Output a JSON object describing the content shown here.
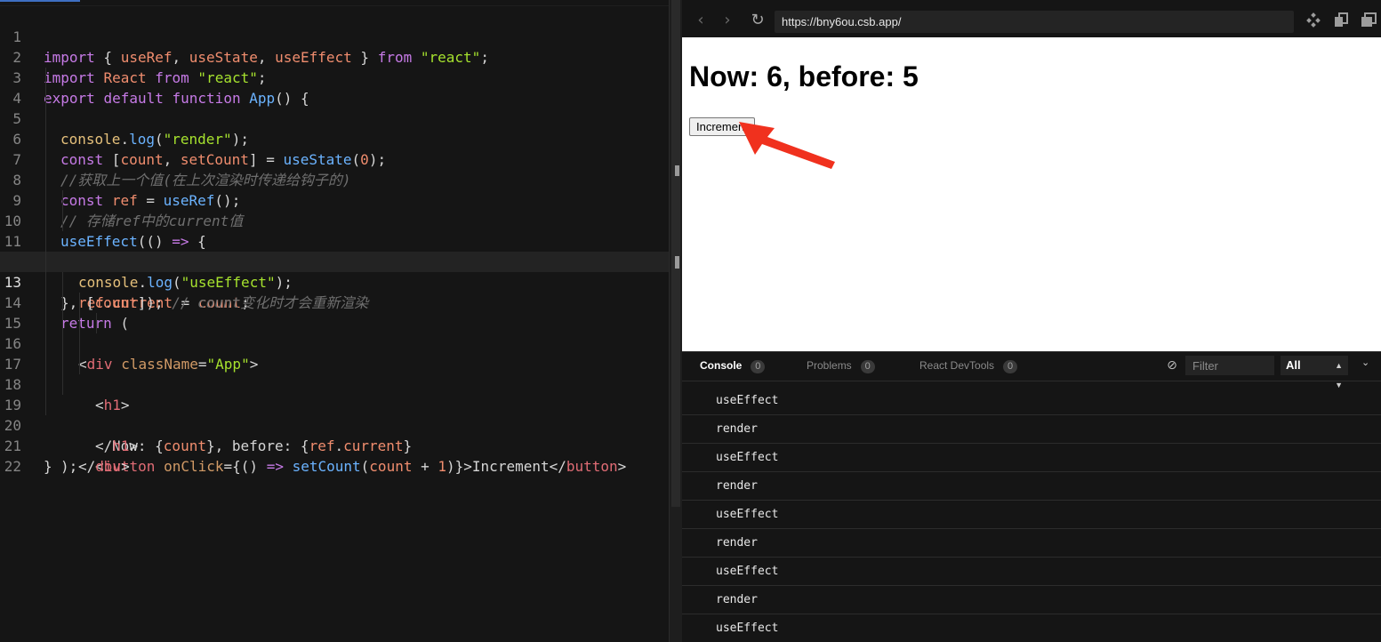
{
  "editor": {
    "lines": [
      {
        "n": "1"
      },
      {
        "n": "2"
      },
      {
        "n": "3"
      },
      {
        "n": "4"
      },
      {
        "n": "5"
      },
      {
        "n": "6"
      },
      {
        "n": "7"
      },
      {
        "n": "8"
      },
      {
        "n": "9"
      },
      {
        "n": "10"
      },
      {
        "n": "11"
      },
      {
        "n": "12"
      },
      {
        "n": "13"
      },
      {
        "n": "14"
      },
      {
        "n": "15"
      },
      {
        "n": "16"
      },
      {
        "n": "17"
      },
      {
        "n": "18"
      },
      {
        "n": "19"
      },
      {
        "n": "20"
      },
      {
        "n": "21"
      },
      {
        "n": "22"
      }
    ],
    "current_line": 13,
    "code": {
      "l1": {
        "import": "import",
        "open": " { ",
        "useRef": "useRef",
        "c1": ", ",
        "useState": "useState",
        "c2": ", ",
        "useEffect": "useEffect",
        "close": " } ",
        "from": "from",
        "sp": " ",
        "str": "\"react\"",
        "semi": ";"
      },
      "l2": {
        "import": "import",
        "sp": " ",
        "React": "React",
        "sp2": " ",
        "from": "from",
        "sp3": " ",
        "str": "\"react\"",
        "semi": ";"
      },
      "l3": {
        "export": "export",
        "sp": " ",
        "default": "default",
        "sp2": " ",
        "function": "function",
        "sp3": " ",
        "App": "App",
        "rest": "() {"
      },
      "l4": {
        "console": "console",
        "dot": ".",
        "log": "log",
        "open": "(",
        "str": "\"render\"",
        "close": ");"
      },
      "l5": {
        "const": "const",
        "open": " [",
        "count": "count",
        "c": ", ",
        "setCount": "setCount",
        "eq": "] = ",
        "useState": "useState",
        "p1": "(",
        "num": "0",
        "p2": ");"
      },
      "l6": {
        "comment": "//获取上一个值(在上次渲染时传递给钩子的)"
      },
      "l7": {
        "const": "const",
        "sp": " ",
        "ref": "ref",
        "eq": " = ",
        "useRef": "useRef",
        "rest": "();"
      },
      "l8": {
        "comment": "// 存储ref中的current值"
      },
      "l9": {
        "useEffect": "useEffect",
        "open": "(() ",
        "arrow": "=>",
        "rest": " {"
      },
      "l10": {
        "console": "console",
        "dot": ".",
        "log": "log",
        "open": "(",
        "str": "\"useEffect\"",
        "close": ");"
      },
      "l11": {
        "ref": "ref",
        "dot": ".",
        "current": "current",
        "eq": " = ",
        "count": "count",
        "semi": ";"
      },
      "l12": {
        "open": "}, [",
        "count": "count",
        "close": "]); ",
        "comment": "// count变化时才会重新渲染"
      },
      "l13": {
        "return": "return",
        "rest": " ("
      },
      "l14": {
        "lt": "<",
        "div": "div",
        "sp": " ",
        "className": "className",
        "eq": "=",
        "str": "\"App\"",
        "gt": ">"
      },
      "l15": {
        "lt": "<",
        "h1": "h1",
        "gt": ">"
      },
      "l16": {
        "pre": "Now: {",
        "count": "count",
        "mid": "}, before: {",
        "ref": "ref",
        "dot": ".",
        "current": "current",
        "post": "}"
      },
      "l17": {
        "lt": "</",
        "h1": "h1",
        "gt": ">"
      },
      "l18": {
        "lt": "<",
        "button": "button",
        "sp": " ",
        "onClick": "onClick",
        "eq": "={() ",
        "arrow": "=>",
        "sp2": " ",
        "setCount": "setCount",
        "p1": "(",
        "count": "count",
        "plus": " + ",
        "num": "1",
        "p2": ")}>Increment</",
        "button2": "button",
        "gt": ">"
      },
      "l19": {
        "lt": "</",
        "div": "div",
        "gt": ">"
      },
      "l20": {
        "text": ");"
      },
      "l21": {
        "text": "}"
      },
      "l22": {
        "text": ""
      }
    }
  },
  "browser": {
    "url": "https://bny6ou.csb.app/",
    "back_icon": "‹",
    "forward_icon": "›",
    "reload_icon": "↻",
    "heading": "Now: 6, before: 5",
    "button_label": "Increment",
    "arrow_color": "#f0311e"
  },
  "console": {
    "tabs": [
      {
        "label": "Console",
        "count": "0"
      },
      {
        "label": "Problems",
        "count": "0"
      },
      {
        "label": "React DevTools",
        "count": "0"
      }
    ],
    "filter_placeholder": "Filter",
    "level": "All",
    "logs": [
      "useEffect",
      "render",
      "useEffect",
      "render",
      "useEffect",
      "render",
      "useEffect",
      "render",
      "useEffect"
    ]
  }
}
